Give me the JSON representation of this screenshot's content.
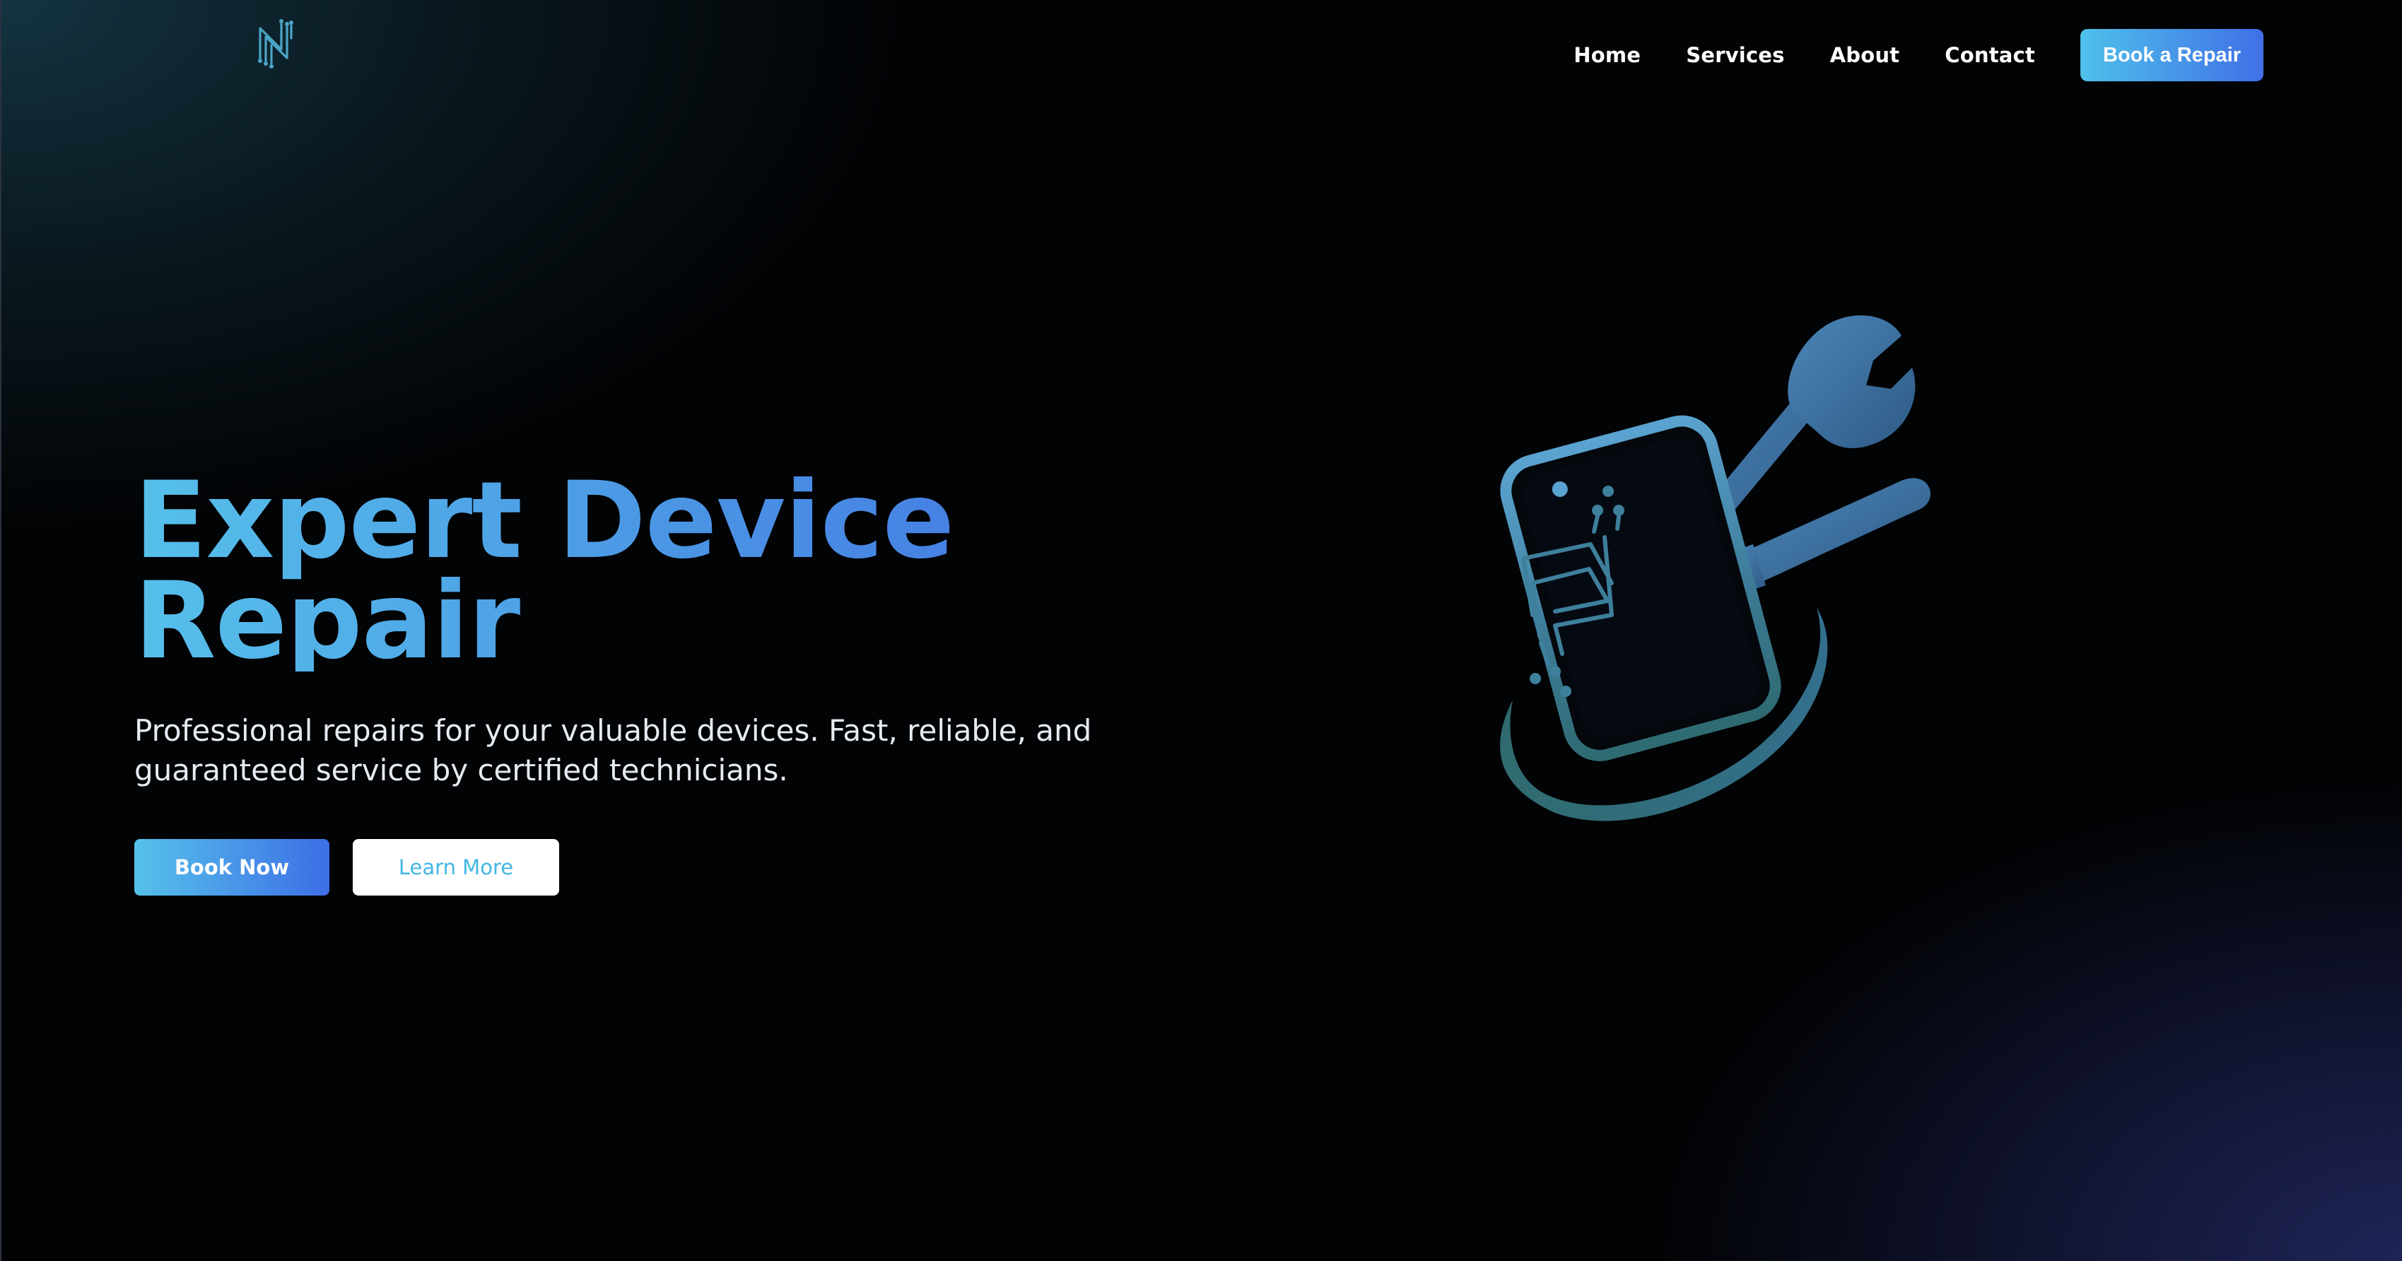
{
  "header": {
    "logo_icon": "circuit-n-logo-icon",
    "nav": {
      "home": "Home",
      "services": "Services",
      "about": "About",
      "contact": "Contact"
    },
    "cta_label": "Book a Repair"
  },
  "hero": {
    "title_line1": "Expert Device",
    "title_line2": "Repair",
    "subtitle_line1": "Professional repairs for your valuable devices. Fast, reliable, and",
    "subtitle_line2": "guaranteed service by certified technicians.",
    "primary_button": "Book Now",
    "secondary_button": "Learn More",
    "illustration_icon": "phone-repair-tools-icon"
  },
  "colors": {
    "accent_start": "#55c1ea",
    "accent_end": "#3d6ee6",
    "background": "#020305"
  }
}
